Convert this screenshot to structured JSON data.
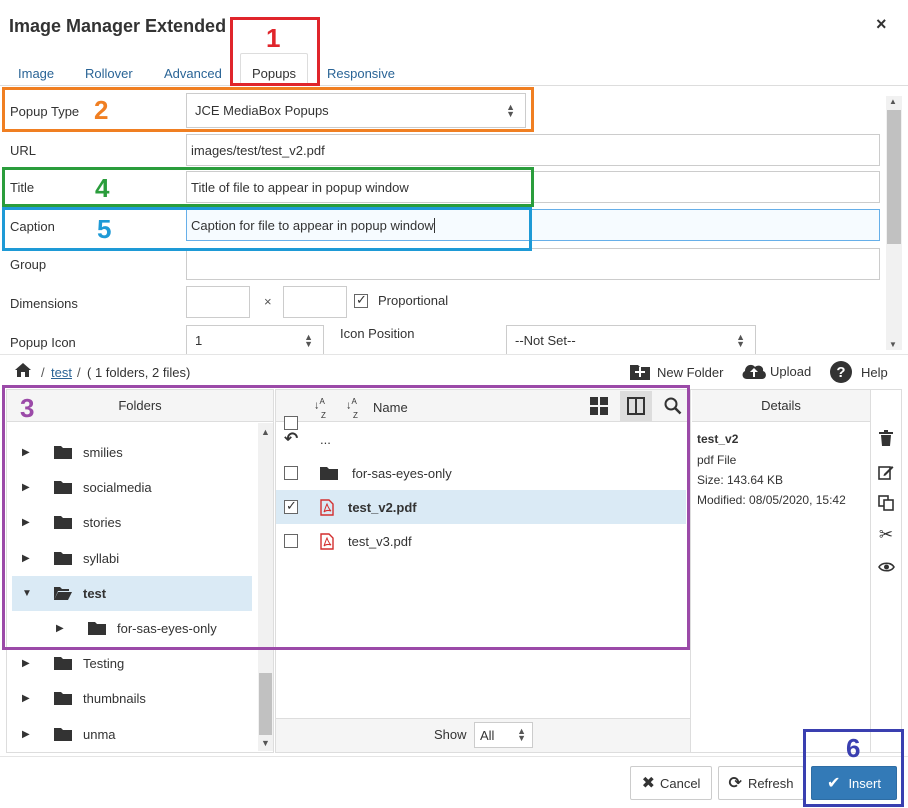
{
  "dialog": {
    "title": "Image Manager Extended",
    "close": "×"
  },
  "tabs": [
    {
      "label": "Image"
    },
    {
      "label": "Rollover"
    },
    {
      "label": "Advanced"
    },
    {
      "label": "Popups",
      "active": true
    },
    {
      "label": "Responsive"
    }
  ],
  "form": {
    "popup_type": {
      "label": "Popup Type",
      "value": "JCE MediaBox Popups"
    },
    "url": {
      "label": "URL",
      "value": "images/test/test_v2.pdf"
    },
    "title": {
      "label": "Title",
      "value": "Title of file to appear in popup window"
    },
    "caption": {
      "label": "Caption",
      "value": "Caption for file to appear in popup window"
    },
    "group": {
      "label": "Group",
      "value": ""
    },
    "dimensions": {
      "label": "Dimensions",
      "times": "×",
      "proportional_label": "Proportional",
      "proportional_checked": true
    },
    "popup_icon": {
      "label": "Popup Icon",
      "value": "1"
    },
    "icon_position": {
      "label": "Icon Position",
      "value": "--Not Set--"
    }
  },
  "browser": {
    "breadcrumb": {
      "folder": "test",
      "separator": "/",
      "summary": "( 1 folders, 2 files)"
    },
    "toolbar": {
      "new_folder": "New Folder",
      "upload": "Upload",
      "help": "Help"
    },
    "folders_header": "Folders",
    "folders": [
      {
        "name": "smilies",
        "expanded": false,
        "selected": false,
        "indent": 0
      },
      {
        "name": "socialmedia",
        "expanded": false,
        "selected": false,
        "indent": 0
      },
      {
        "name": "stories",
        "expanded": false,
        "selected": false,
        "indent": 0
      },
      {
        "name": "syllabi",
        "expanded": false,
        "selected": false,
        "indent": 0
      },
      {
        "name": "test",
        "expanded": true,
        "selected": true,
        "indent": 0
      },
      {
        "name": "for-sas-eyes-only",
        "expanded": false,
        "selected": false,
        "indent": 1
      },
      {
        "name": "Testing",
        "expanded": false,
        "selected": false,
        "indent": 0
      },
      {
        "name": "thumbnails",
        "expanded": false,
        "selected": false,
        "indent": 0
      },
      {
        "name": "unma",
        "expanded": false,
        "selected": false,
        "indent": 0
      }
    ],
    "files_header": {
      "name": "Name"
    },
    "files": [
      {
        "name": "...",
        "type": "up"
      },
      {
        "name": "for-sas-eyes-only",
        "type": "folder",
        "checked": false
      },
      {
        "name": "test_v2.pdf",
        "type": "pdf",
        "checked": true,
        "selected": true
      },
      {
        "name": "test_v3.pdf",
        "type": "pdf",
        "checked": false
      }
    ],
    "show": {
      "label": "Show",
      "value": "All"
    },
    "details": {
      "header": "Details",
      "name": "test_v2",
      "type": "pdf File",
      "size": "Size: 143.64 KB",
      "modified": "Modified: 08/05/2020, 15:42"
    }
  },
  "buttons": {
    "cancel": "Cancel",
    "refresh": "Refresh",
    "insert": "Insert"
  },
  "annotations": [
    {
      "num": "1",
      "color": "#e0252b"
    },
    {
      "num": "2",
      "color": "#f07f22"
    },
    {
      "num": "3",
      "color": "#9b4aa8"
    },
    {
      "num": "4",
      "color": "#2a9d3c"
    },
    {
      "num": "5",
      "color": "#1e9ad6"
    },
    {
      "num": "6",
      "color": "#3a3fb0"
    }
  ],
  "colors": {
    "link": "#2a6496",
    "selected_row": "#daeaf5",
    "primary": "#337ab7",
    "pdf": "#d32f2f"
  }
}
